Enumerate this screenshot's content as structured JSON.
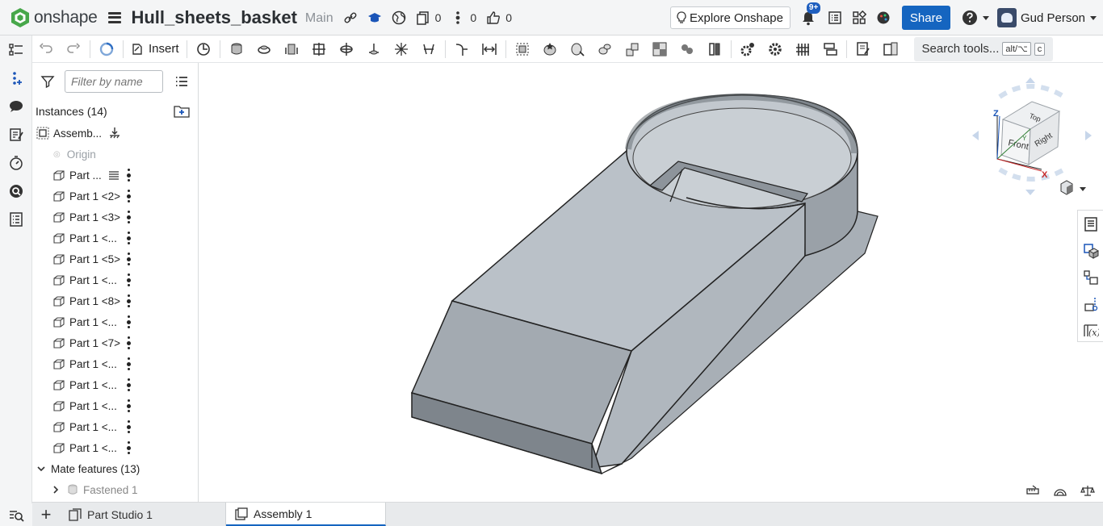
{
  "app": {
    "logo_text": "onshape",
    "document_title": "Hull_sheets_basket",
    "branch": "Main",
    "versions_count": "0",
    "branches_count": "0",
    "likes_count": "0",
    "explore_label": "Explore Onshape",
    "notifications_badge": "9+",
    "share_label": "Share",
    "user_name": "Gud Person"
  },
  "toolbar": {
    "insert_label": "Insert",
    "search_label": "Search tools...",
    "search_kbd_1": "alt/⌥",
    "search_kbd_2": "c"
  },
  "panel": {
    "filter_placeholder": "Filter by name",
    "instances_header": "Instances (14)",
    "assembly_label": "Assemb...",
    "origin_label": "Origin",
    "parts": [
      "Part ...",
      "Part 1 <2>",
      "Part 1 <3>",
      "Part 1 <...",
      "Part 1 <5>",
      "Part 1 <...",
      "Part 1 <8>",
      "Part 1 <...",
      "Part 1 <7>",
      "Part 1 <...",
      "Part 1 <...",
      "Part 1 <...",
      "Part 1 <...",
      "Part 1 <..."
    ],
    "mate_header": "Mate features (13)",
    "mate_first": "Fastened 1"
  },
  "viewcube": {
    "top": "Top",
    "front": "Front",
    "right": "Right",
    "z": "Z",
    "x": "X",
    "y": "Y"
  },
  "tabs": [
    {
      "label": "Part Studio 1",
      "active": false
    },
    {
      "label": "Assembly 1",
      "active": true
    }
  ],
  "colors": {
    "accent": "#1565c0",
    "model_top": "#bac1c8",
    "model_side": "#a3aab1",
    "model_dark": "#7e858c"
  }
}
